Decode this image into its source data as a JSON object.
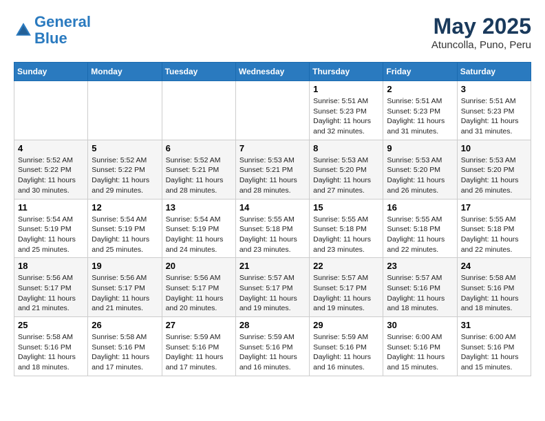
{
  "header": {
    "logo_line1": "General",
    "logo_line2": "Blue",
    "month_year": "May 2025",
    "location": "Atuncolla, Puno, Peru"
  },
  "days_of_week": [
    "Sunday",
    "Monday",
    "Tuesday",
    "Wednesday",
    "Thursday",
    "Friday",
    "Saturday"
  ],
  "weeks": [
    [
      {
        "day": "",
        "sunrise": "",
        "sunset": "",
        "daylight": ""
      },
      {
        "day": "",
        "sunrise": "",
        "sunset": "",
        "daylight": ""
      },
      {
        "day": "",
        "sunrise": "",
        "sunset": "",
        "daylight": ""
      },
      {
        "day": "",
        "sunrise": "",
        "sunset": "",
        "daylight": ""
      },
      {
        "day": "1",
        "sunrise": "5:51 AM",
        "sunset": "5:23 PM",
        "daylight": "11 hours and 32 minutes."
      },
      {
        "day": "2",
        "sunrise": "5:51 AM",
        "sunset": "5:23 PM",
        "daylight": "11 hours and 31 minutes."
      },
      {
        "day": "3",
        "sunrise": "5:51 AM",
        "sunset": "5:23 PM",
        "daylight": "11 hours and 31 minutes."
      }
    ],
    [
      {
        "day": "4",
        "sunrise": "5:52 AM",
        "sunset": "5:22 PM",
        "daylight": "11 hours and 30 minutes."
      },
      {
        "day": "5",
        "sunrise": "5:52 AM",
        "sunset": "5:22 PM",
        "daylight": "11 hours and 29 minutes."
      },
      {
        "day": "6",
        "sunrise": "5:52 AM",
        "sunset": "5:21 PM",
        "daylight": "11 hours and 28 minutes."
      },
      {
        "day": "7",
        "sunrise": "5:53 AM",
        "sunset": "5:21 PM",
        "daylight": "11 hours and 28 minutes."
      },
      {
        "day": "8",
        "sunrise": "5:53 AM",
        "sunset": "5:20 PM",
        "daylight": "11 hours and 27 minutes."
      },
      {
        "day": "9",
        "sunrise": "5:53 AM",
        "sunset": "5:20 PM",
        "daylight": "11 hours and 26 minutes."
      },
      {
        "day": "10",
        "sunrise": "5:53 AM",
        "sunset": "5:20 PM",
        "daylight": "11 hours and 26 minutes."
      }
    ],
    [
      {
        "day": "11",
        "sunrise": "5:54 AM",
        "sunset": "5:19 PM",
        "daylight": "11 hours and 25 minutes."
      },
      {
        "day": "12",
        "sunrise": "5:54 AM",
        "sunset": "5:19 PM",
        "daylight": "11 hours and 25 minutes."
      },
      {
        "day": "13",
        "sunrise": "5:54 AM",
        "sunset": "5:19 PM",
        "daylight": "11 hours and 24 minutes."
      },
      {
        "day": "14",
        "sunrise": "5:55 AM",
        "sunset": "5:18 PM",
        "daylight": "11 hours and 23 minutes."
      },
      {
        "day": "15",
        "sunrise": "5:55 AM",
        "sunset": "5:18 PM",
        "daylight": "11 hours and 23 minutes."
      },
      {
        "day": "16",
        "sunrise": "5:55 AM",
        "sunset": "5:18 PM",
        "daylight": "11 hours and 22 minutes."
      },
      {
        "day": "17",
        "sunrise": "5:55 AM",
        "sunset": "5:18 PM",
        "daylight": "11 hours and 22 minutes."
      }
    ],
    [
      {
        "day": "18",
        "sunrise": "5:56 AM",
        "sunset": "5:17 PM",
        "daylight": "11 hours and 21 minutes."
      },
      {
        "day": "19",
        "sunrise": "5:56 AM",
        "sunset": "5:17 PM",
        "daylight": "11 hours and 21 minutes."
      },
      {
        "day": "20",
        "sunrise": "5:56 AM",
        "sunset": "5:17 PM",
        "daylight": "11 hours and 20 minutes."
      },
      {
        "day": "21",
        "sunrise": "5:57 AM",
        "sunset": "5:17 PM",
        "daylight": "11 hours and 19 minutes."
      },
      {
        "day": "22",
        "sunrise": "5:57 AM",
        "sunset": "5:17 PM",
        "daylight": "11 hours and 19 minutes."
      },
      {
        "day": "23",
        "sunrise": "5:57 AM",
        "sunset": "5:16 PM",
        "daylight": "11 hours and 18 minutes."
      },
      {
        "day": "24",
        "sunrise": "5:58 AM",
        "sunset": "5:16 PM",
        "daylight": "11 hours and 18 minutes."
      }
    ],
    [
      {
        "day": "25",
        "sunrise": "5:58 AM",
        "sunset": "5:16 PM",
        "daylight": "11 hours and 18 minutes."
      },
      {
        "day": "26",
        "sunrise": "5:58 AM",
        "sunset": "5:16 PM",
        "daylight": "11 hours and 17 minutes."
      },
      {
        "day": "27",
        "sunrise": "5:59 AM",
        "sunset": "5:16 PM",
        "daylight": "11 hours and 17 minutes."
      },
      {
        "day": "28",
        "sunrise": "5:59 AM",
        "sunset": "5:16 PM",
        "daylight": "11 hours and 16 minutes."
      },
      {
        "day": "29",
        "sunrise": "5:59 AM",
        "sunset": "5:16 PM",
        "daylight": "11 hours and 16 minutes."
      },
      {
        "day": "30",
        "sunrise": "6:00 AM",
        "sunset": "5:16 PM",
        "daylight": "11 hours and 15 minutes."
      },
      {
        "day": "31",
        "sunrise": "6:00 AM",
        "sunset": "5:16 PM",
        "daylight": "11 hours and 15 minutes."
      }
    ]
  ]
}
